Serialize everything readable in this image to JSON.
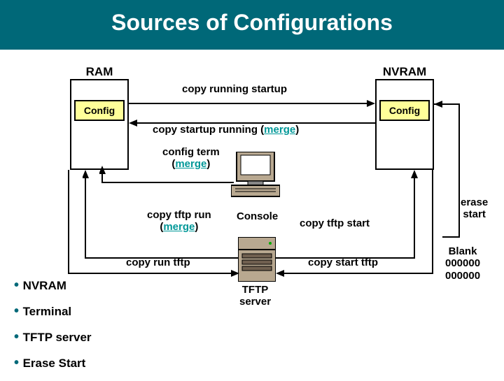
{
  "title": "Sources of Configurations",
  "ram_label": "RAM",
  "nvram_label": "NVRAM",
  "config_label": "Config",
  "commands": {
    "copy_running_startup": "copy running startup",
    "copy_startup_running": "copy startup running",
    "config_term": "config term",
    "copy_tftp_run": "copy tftp run",
    "copy_tftp_start": "copy tftp start",
    "copy_run_tftp": "copy run tftp",
    "copy_start_tftp": "copy start tftp",
    "merge": "(merge)",
    "merge_plain": "merge"
  },
  "console_label": "Console",
  "tftp_label": "TFTP\nserver",
  "erase_start": "erase\nstart",
  "blank": "Blank\n000000\n000000",
  "bullets": [
    "NVRAM",
    "Terminal",
    "TFTP server",
    "Erase Start"
  ]
}
